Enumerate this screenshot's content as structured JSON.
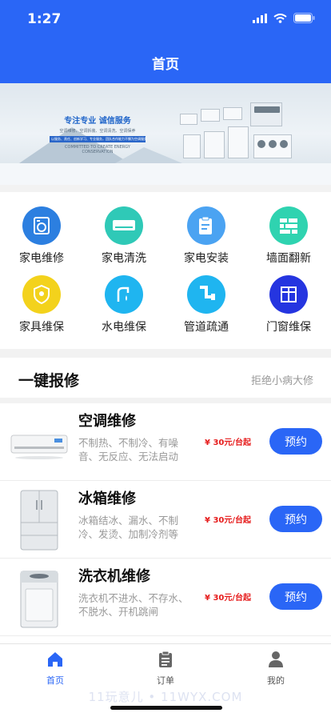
{
  "status_bar": {
    "time": "1:27"
  },
  "nav": {
    "title": "首页"
  },
  "banner": {
    "title": "专注专业  诚信服务",
    "subtitle": "空调维修、空调拆装、空调清洗、空调保养",
    "line": "以服务、责任、创新学习、专业服务，团队合作能力不懈为空调服务",
    "caption": "COMMITTED TO CREATE ENERGY CONSERVATION",
    "slide_count": 3,
    "active_slide": 3
  },
  "categories": [
    {
      "label": "家电维修",
      "icon": "washing-machine-icon",
      "color": "#2c7fe0"
    },
    {
      "label": "家电清洗",
      "icon": "air-conditioner-icon",
      "color": "#2fc9b7"
    },
    {
      "label": "家电安装",
      "icon": "clipboard-icon",
      "color": "#4ba3f2"
    },
    {
      "label": "墙面翻新",
      "icon": "bricks-icon",
      "color": "#2fd3b0"
    },
    {
      "label": "家具维保",
      "icon": "shield-wrench-icon",
      "color": "#f3d21c"
    },
    {
      "label": "水电维保",
      "icon": "faucet-icon",
      "color": "#1fb5f0"
    },
    {
      "label": "管道疏通",
      "icon": "pipe-icon",
      "color": "#1fb5f0"
    },
    {
      "label": "门窗维保",
      "icon": "window-icon",
      "color": "#2535e0"
    }
  ],
  "section": {
    "title": "一键报修",
    "subtitle": "拒绝小病大修"
  },
  "services": [
    {
      "name": "空调维修",
      "desc": "不制热、不制冷、有噪音、无反应、无法启动",
      "price_symbol": "¥",
      "price": "30",
      "price_unit": "元/台起",
      "button": "预约",
      "image": "air-conditioner-image"
    },
    {
      "name": "冰箱维修",
      "desc": "冰箱结冰、漏水、不制冷、发烫、加制冷剂等",
      "price_symbol": "¥",
      "price": "30",
      "price_unit": "元/台起",
      "button": "预约",
      "image": "fridge-image"
    },
    {
      "name": "洗衣机维修",
      "desc": "洗衣机不进水、不存水、不脱水、开机跳闸",
      "price_symbol": "¥",
      "price": "30",
      "price_unit": "元/台起",
      "button": "预约",
      "image": "washing-machine-image"
    }
  ],
  "tabbar": [
    {
      "label": "首页",
      "icon": "home-icon",
      "active": true
    },
    {
      "label": "订单",
      "icon": "orders-icon",
      "active": false
    },
    {
      "label": "我的",
      "icon": "profile-icon",
      "active": false
    }
  ],
  "watermark": "11玩意儿 • 11WYX.COM",
  "colors": {
    "primary": "#2a66f6",
    "price": "#e61b1b",
    "muted": "#999999"
  }
}
